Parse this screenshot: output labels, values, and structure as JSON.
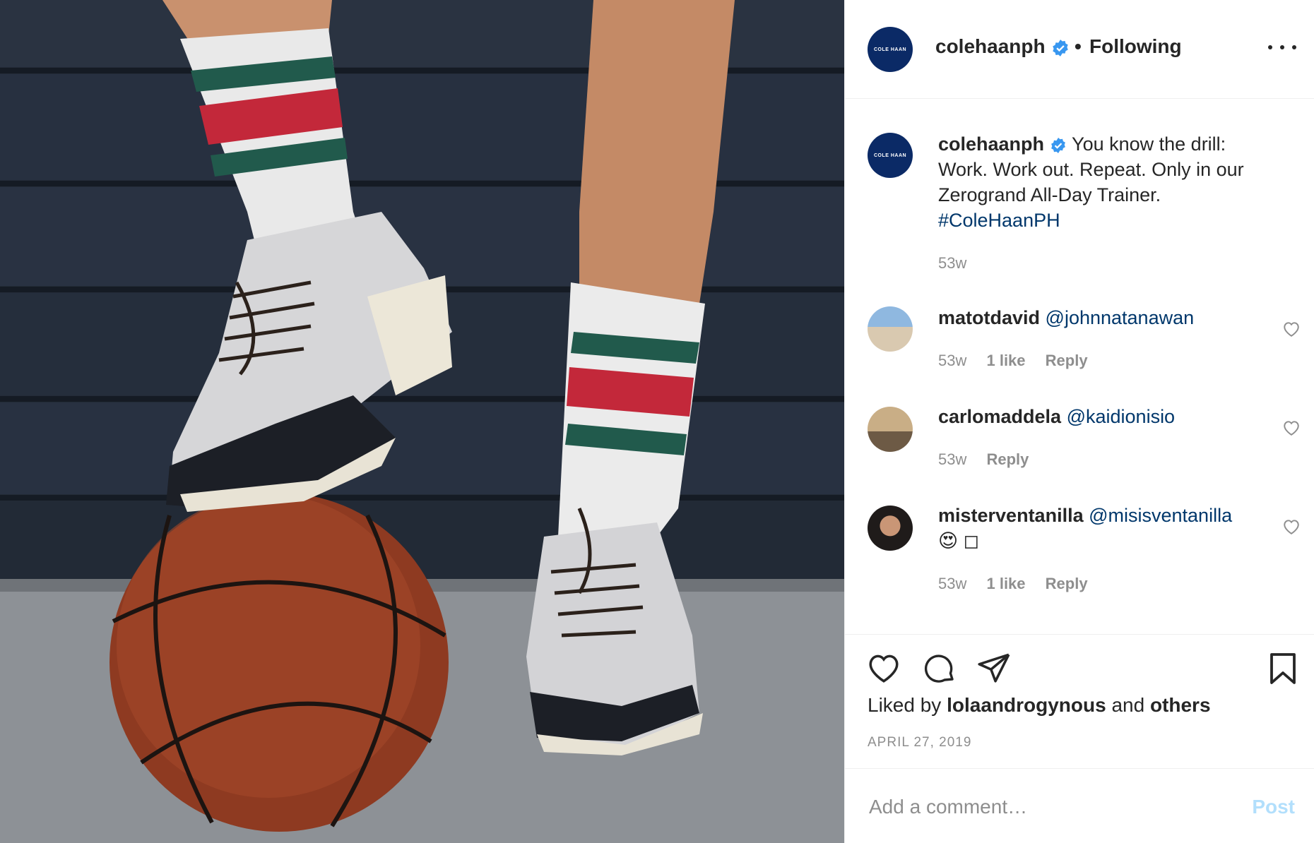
{
  "post": {
    "author": "colehaanph",
    "avatar_text": "COLE HAAN",
    "separator": "•",
    "follow_state": "Following",
    "caption": {
      "username": "colehaanph",
      "text": "You know the drill: Work. Work out. Repeat. Only in our Zerogrand All-Day Trainer.",
      "hashtag": "#ColeHaanPH",
      "time": "53w"
    },
    "comments": [
      {
        "username": "matotdavid",
        "mention": "@johnnatanawan",
        "extra": "",
        "time": "53w",
        "likes": "1 like",
        "reply": "Reply"
      },
      {
        "username": "carlomaddela",
        "mention": "@kaidionisio",
        "extra": "",
        "time": "53w",
        "likes": "",
        "reply": "Reply"
      },
      {
        "username": "misterventanilla",
        "mention": "@misisventanilla",
        "extra": "😍 ◻",
        "time": "53w",
        "likes": "1 like",
        "reply": "Reply"
      }
    ],
    "liked_by": {
      "prefix": "Liked by",
      "user": "lolaandrogynous",
      "mid": "and",
      "others": "others"
    },
    "date": "APRIL 27, 2019",
    "add_comment_placeholder": "Add a comment…",
    "post_label": "Post"
  },
  "icons": {
    "verified": "verified-badge-icon",
    "more": "more-options-icon",
    "like": "heart-icon",
    "comment": "comment-bubble-icon",
    "share": "paper-plane-icon",
    "save": "bookmark-icon"
  },
  "colors": {
    "verified": "#3897f0",
    "link": "#00376b",
    "muted": "#8e8e8e",
    "post_button": "#b2dffc",
    "brand": "#0b2a66"
  }
}
